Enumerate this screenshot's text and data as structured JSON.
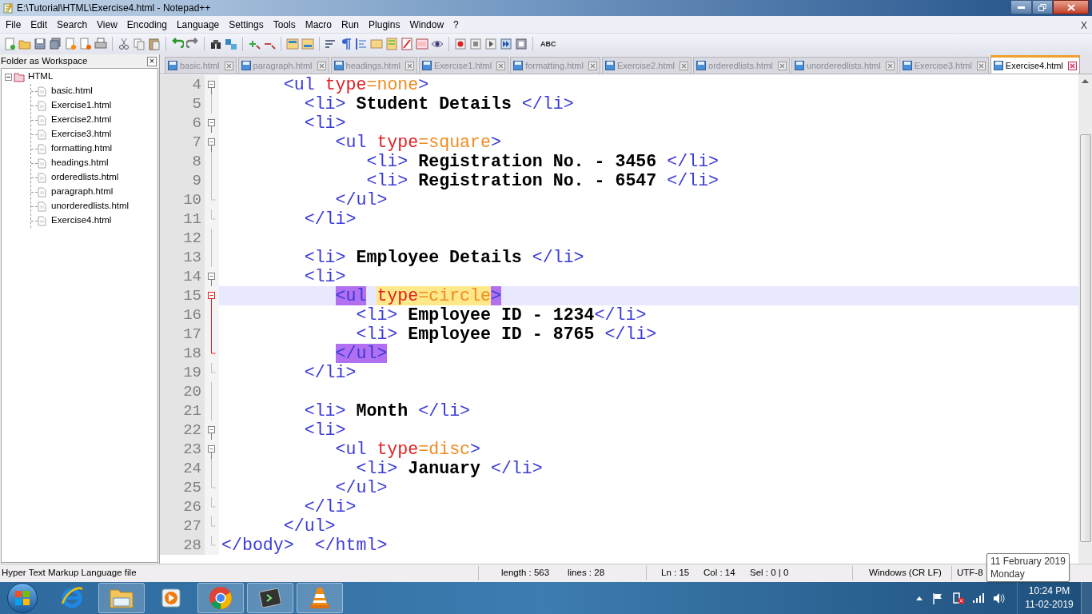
{
  "window": {
    "title": "E:\\Tutorial\\HTML\\Exercise4.html - Notepad++"
  },
  "menu": [
    "File",
    "Edit",
    "Search",
    "View",
    "Encoding",
    "Language",
    "Settings",
    "Tools",
    "Macro",
    "Run",
    "Plugins",
    "Window",
    "?"
  ],
  "menu_close": "X",
  "toolbar": {
    "spellcheck_label": "ABC"
  },
  "workspace": {
    "title": "Folder as Workspace",
    "close": "×",
    "tree": [
      {
        "label": "HTML",
        "expanded": true,
        "children": [
          {
            "label": "basic.html"
          },
          {
            "label": "Exercise1.html"
          },
          {
            "label": "Exercise2.html"
          },
          {
            "label": "Exercise3.html"
          },
          {
            "label": "formatting.html"
          },
          {
            "label": "headings.html"
          },
          {
            "label": "orderedlists.html"
          },
          {
            "label": "paragraph.html"
          },
          {
            "label": "unorderedlists.html"
          },
          {
            "label": "Exercise4.html"
          }
        ]
      }
    ]
  },
  "tabs": [
    {
      "label": "basic.html",
      "selected": false
    },
    {
      "label": "paragraph.html",
      "selected": false
    },
    {
      "label": "headings.html",
      "selected": false
    },
    {
      "label": "Exercise1.html",
      "selected": false
    },
    {
      "label": "formatting.html",
      "selected": false
    },
    {
      "label": "Exercise2.html",
      "selected": false
    },
    {
      "label": "orderedlists.html",
      "selected": false
    },
    {
      "label": "unorderedlists.html",
      "selected": false
    },
    {
      "label": "Exercise3.html",
      "selected": false
    },
    {
      "label": "Exercise4.html",
      "selected": true
    }
  ],
  "editor": {
    "lines": [
      {
        "number": "4",
        "fold_start": true,
        "fold_end": false,
        "active_fold": false,
        "current": false,
        "tokens": [
          {
            "kind": "tag",
            "text": "      <ul"
          },
          {
            "kind": "attr",
            "text": " type"
          },
          {
            "kind": "value",
            "text": "=none"
          },
          {
            "kind": "tag",
            "text": ">"
          }
        ]
      },
      {
        "number": "5",
        "fold_start": false,
        "fold_end": false,
        "active_fold": false,
        "current": false,
        "tokens": [
          {
            "kind": "tag",
            "text": "        <li>"
          },
          {
            "kind": "text",
            "text": " Student Details "
          },
          {
            "kind": "tag",
            "text": "</li>"
          }
        ]
      },
      {
        "number": "6",
        "fold_start": true,
        "fold_end": false,
        "active_fold": false,
        "current": false,
        "tokens": [
          {
            "kind": "tag",
            "text": "        <li>"
          }
        ]
      },
      {
        "number": "7",
        "fold_start": true,
        "fold_end": false,
        "active_fold": false,
        "current": false,
        "tokens": [
          {
            "kind": "tag",
            "text": "           <ul"
          },
          {
            "kind": "attr",
            "text": " type"
          },
          {
            "kind": "value",
            "text": "=square"
          },
          {
            "kind": "tag",
            "text": ">"
          }
        ]
      },
      {
        "number": "8",
        "fold_start": false,
        "fold_end": false,
        "active_fold": false,
        "current": false,
        "tokens": [
          {
            "kind": "tag",
            "text": "              <li>"
          },
          {
            "kind": "text",
            "text": " Registration No. - 3456 "
          },
          {
            "kind": "tag",
            "text": "</li>"
          }
        ]
      },
      {
        "number": "9",
        "fold_start": false,
        "fold_end": false,
        "active_fold": false,
        "current": false,
        "tokens": [
          {
            "kind": "tag",
            "text": "              <li>"
          },
          {
            "kind": "text",
            "text": " Registration No. - 6547 "
          },
          {
            "kind": "tag",
            "text": "</li>"
          }
        ]
      },
      {
        "number": "10",
        "fold_start": false,
        "fold_end": true,
        "active_fold": false,
        "current": false,
        "tokens": [
          {
            "kind": "tag",
            "text": "           </ul>"
          }
        ]
      },
      {
        "number": "11",
        "fold_start": false,
        "fold_end": true,
        "active_fold": false,
        "current": false,
        "tokens": [
          {
            "kind": "tag",
            "text": "        </li>"
          }
        ]
      },
      {
        "number": "12",
        "fold_start": false,
        "fold_end": false,
        "active_fold": false
      },
      {
        "number": "13",
        "fold_start": false,
        "fold_end": false,
        "active_fold": false,
        "current": false,
        "tokens": [
          {
            "kind": "tag",
            "text": "        <li>"
          },
          {
            "kind": "text",
            "text": " Employee Details "
          },
          {
            "kind": "tag",
            "text": "</li>"
          }
        ]
      },
      {
        "number": "14",
        "fold_start": true,
        "fold_end": false,
        "active_fold": false,
        "current": false,
        "tokens": [
          {
            "kind": "tag",
            "text": "        <li>"
          }
        ]
      },
      {
        "number": "15",
        "fold_start": true,
        "fold_end": false,
        "active_fold": true,
        "current": true,
        "tokens": [
          {
            "kind": "tag",
            "text": "           <ul",
            "brace_match": true
          },
          {
            "kind": "attr",
            "text": " type",
            "smart_highlight": true
          },
          {
            "kind": "value",
            "text": "=circle",
            "smart_highlight": true
          },
          {
            "kind": "tag",
            "text": ">",
            "brace_match": true
          }
        ]
      },
      {
        "number": "16",
        "fold_start": false,
        "fold_end": false,
        "active_fold": true,
        "current": false,
        "tokens": [
          {
            "kind": "tag",
            "text": "             <li>"
          },
          {
            "kind": "text",
            "text": " Employee ID - 1234"
          },
          {
            "kind": "tag",
            "text": "</li>"
          }
        ]
      },
      {
        "number": "17",
        "fold_start": false,
        "fold_end": false,
        "active_fold": true,
        "current": false,
        "tokens": [
          {
            "kind": "tag",
            "text": "             <li>"
          },
          {
            "kind": "text",
            "text": " Employee ID - 8765 "
          },
          {
            "kind": "tag",
            "text": "</li>"
          }
        ]
      },
      {
        "number": "18",
        "fold_start": false,
        "fold_end": true,
        "active_fold": true,
        "current": false,
        "tokens": [
          {
            "kind": "tag",
            "text": "           </ul>",
            "brace_match": true
          }
        ]
      },
      {
        "number": "19",
        "fold_start": false,
        "fold_end": true,
        "active_fold": false,
        "current": false,
        "tokens": [
          {
            "kind": "tag",
            "text": "        </li>"
          }
        ]
      },
      {
        "number": "20",
        "fold_start": false,
        "fold_end": false,
        "active_fold": false
      },
      {
        "number": "21",
        "fold_start": false,
        "fold_end": false,
        "active_fold": false,
        "current": false,
        "tokens": [
          {
            "kind": "tag",
            "text": "        <li>"
          },
          {
            "kind": "text",
            "text": " Month "
          },
          {
            "kind": "tag",
            "text": "</li>"
          }
        ]
      },
      {
        "number": "22",
        "fold_start": true,
        "fold_end": false,
        "active_fold": false,
        "current": false,
        "tokens": [
          {
            "kind": "tag",
            "text": "        <li>"
          }
        ]
      },
      {
        "number": "23",
        "fold_start": true,
        "fold_end": false,
        "active_fold": false,
        "current": false,
        "tokens": [
          {
            "kind": "tag",
            "text": "           <ul"
          },
          {
            "kind": "attr",
            "text": " type"
          },
          {
            "kind": "value",
            "text": "=disc"
          },
          {
            "kind": "tag",
            "text": ">"
          }
        ]
      },
      {
        "number": "24",
        "fold_start": false,
        "fold_end": false,
        "active_fold": false,
        "current": false,
        "tokens": [
          {
            "kind": "tag",
            "text": "             <li>"
          },
          {
            "kind": "text",
            "text": " January "
          },
          {
            "kind": "tag",
            "text": "</li>"
          }
        ]
      },
      {
        "number": "25",
        "fold_start": false,
        "fold_end": true,
        "active_fold": false,
        "current": false,
        "tokens": [
          {
            "kind": "tag",
            "text": "           </ul>"
          }
        ]
      },
      {
        "number": "26",
        "fold_start": false,
        "fold_end": true,
        "active_fold": false,
        "current": false,
        "tokens": [
          {
            "kind": "tag",
            "text": "        </li>"
          }
        ]
      },
      {
        "number": "27",
        "fold_start": false,
        "fold_end": true,
        "active_fold": false,
        "current": false,
        "tokens": [
          {
            "kind": "tag",
            "text": "      </ul>"
          }
        ]
      },
      {
        "number": "28",
        "fold_start": false,
        "fold_end": true,
        "active_fold": false,
        "current": false,
        "tokens": [
          {
            "kind": "tag",
            "text": "</body>  </html>"
          }
        ]
      }
    ]
  },
  "status_bar": {
    "file_type": "Hyper Text Markup Language file",
    "length": "length : 563",
    "lines": "lines : 28",
    "ln": "Ln : 15",
    "col": "Col : 14",
    "sel": "Sel : 0 | 0",
    "eol": "Windows (CR LF)",
    "encoding": "UTF-8"
  },
  "tooltip": [
    "11 February 2019",
    "Monday"
  ],
  "taskbar": {
    "time": "10:24 PM",
    "date": "11-02-2019"
  }
}
